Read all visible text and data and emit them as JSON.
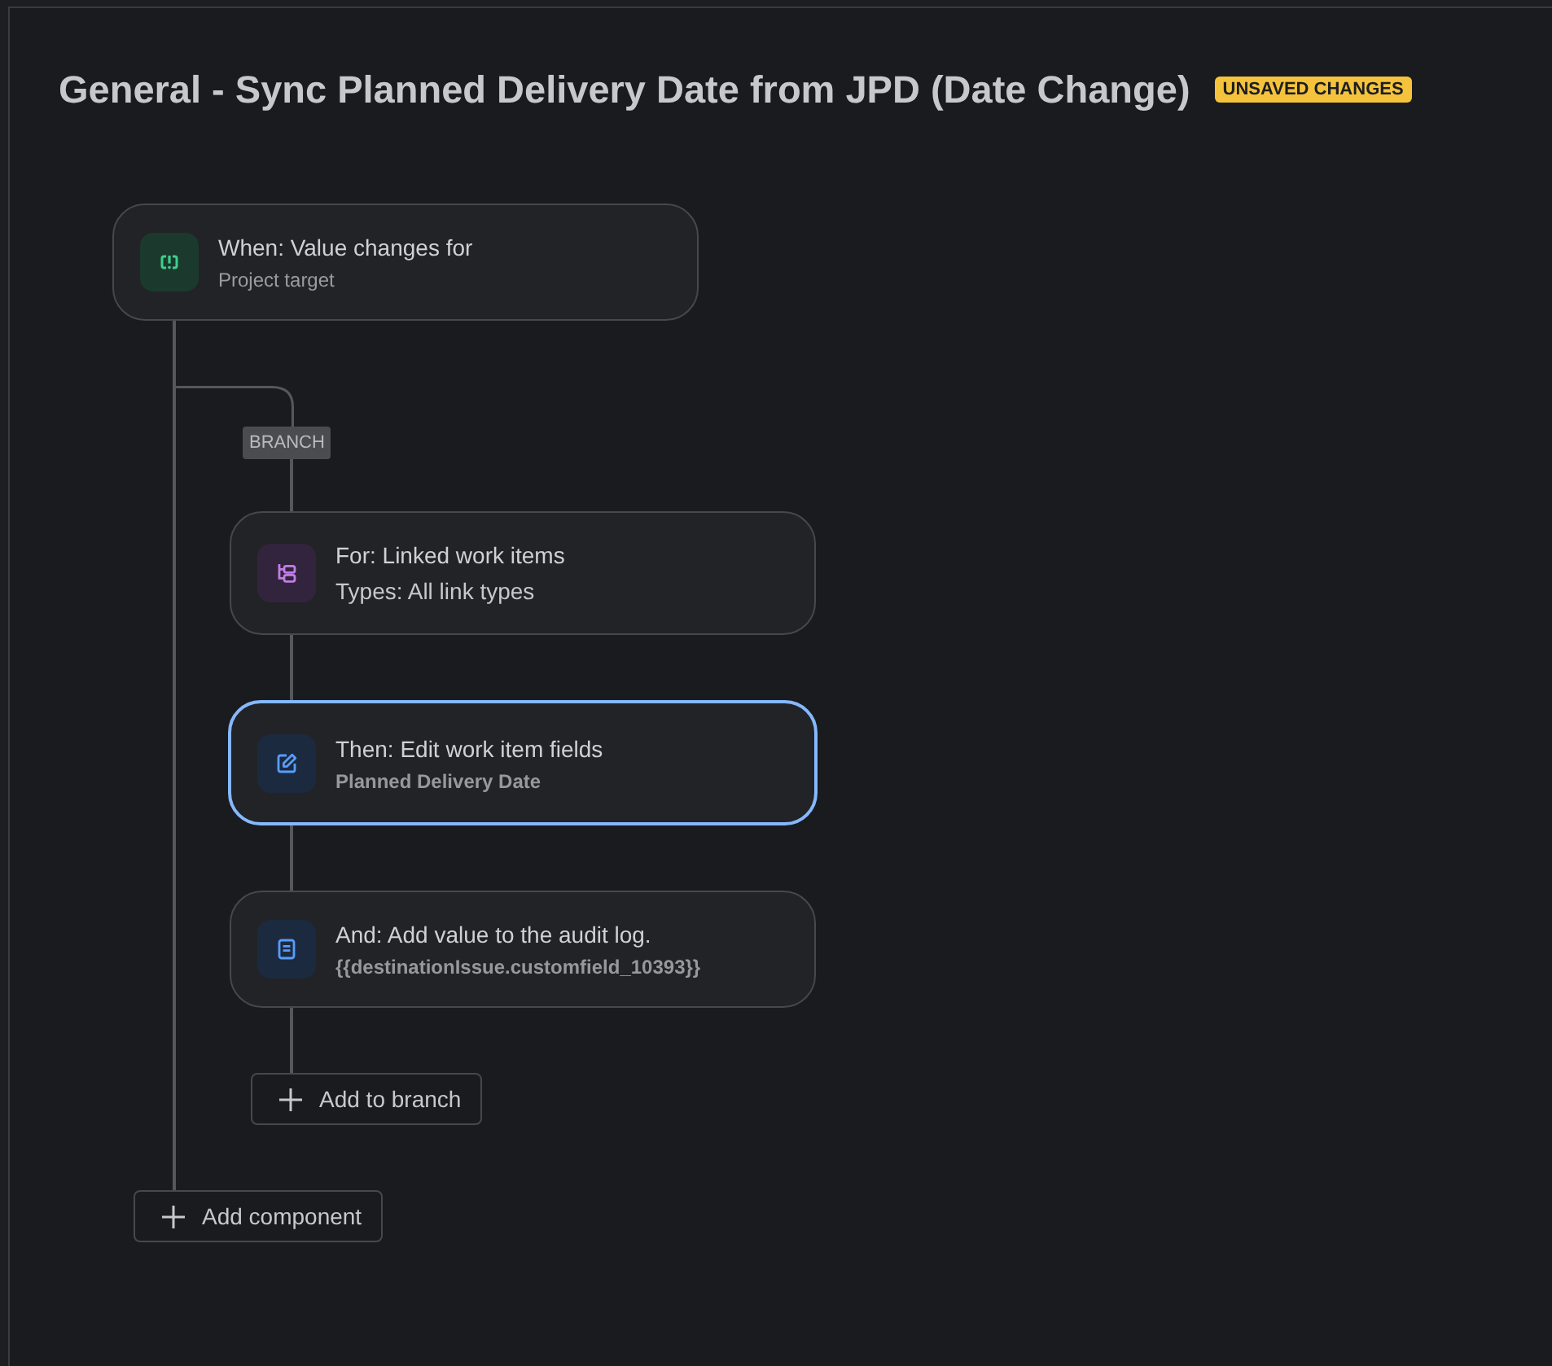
{
  "header": {
    "title": "General - Sync Planned Delivery Date from JPD (Date Change)",
    "badge": "UNSAVED CHANGES"
  },
  "trigger": {
    "kind": "trigger",
    "title": "When: Value changes for",
    "subtitle": "Project target",
    "selected": false
  },
  "branch": {
    "label": "BRANCH",
    "components": [
      {
        "kind": "branch",
        "title": "For: Linked work items",
        "subtitle": "Types: All link types",
        "selected": false
      },
      {
        "kind": "edit",
        "title": "Then: Edit work item fields",
        "subtitle": "Planned Delivery Date",
        "selected": true
      },
      {
        "kind": "log",
        "title": "And: Add value to the audit log.",
        "subtitle": "{{destinationIssue.customfield_10393}}",
        "selected": false
      }
    ],
    "add_button": "Add to branch"
  },
  "add_component_button": "Add component"
}
